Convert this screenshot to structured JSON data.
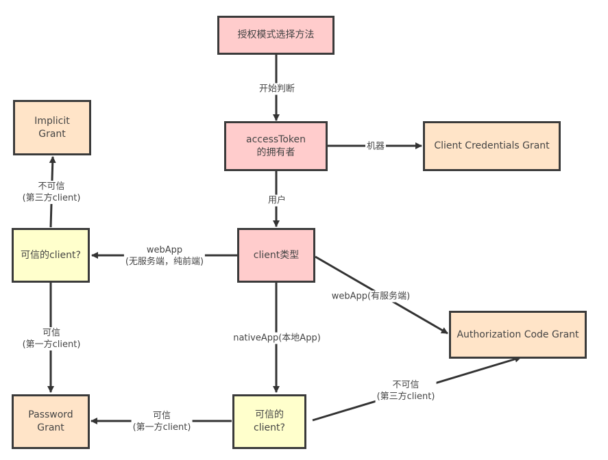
{
  "nodes": {
    "start": "授权模式选择方法",
    "owner": "accessToken\n的拥有者",
    "client_credentials": "Client  Credentials Grant",
    "client_type": "client类型",
    "implicit": "Implicit\nGrant",
    "trusted_web": "可信的client?",
    "auth_code": "Authorization Code Grant",
    "password": "Password\nGrant",
    "trusted_native": "可信的\nclient?"
  },
  "edges": {
    "start_to_owner": "开始判断",
    "owner_to_cc": "机器",
    "owner_to_type": "用户",
    "type_to_trusted_web": "webApp\n(无服务端，纯前端)",
    "type_to_auth_code": "webApp(有服务端)",
    "type_to_trusted_native": "nativeApp(本地App)",
    "trusted_web_to_implicit": "不可信\n(第三方client)",
    "trusted_web_to_password": "可信\n(第一方client)",
    "trusted_native_to_password": "可信\n(第一方client)",
    "trusted_native_to_auth_code": "不可信\n(第三方client)"
  },
  "colors": {
    "decision_pink": "#ffcccc",
    "grant_peach": "#ffe4c8",
    "question_yellow": "#ffffcc",
    "stroke": "#3a3a3a"
  }
}
